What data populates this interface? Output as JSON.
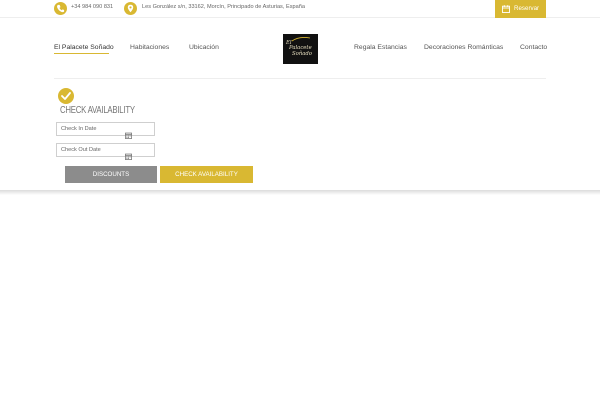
{
  "topbar": {
    "phone": "+34 984 090 831",
    "address": "Les González s/n, 33162, Morcín, Principado de Asturias, España",
    "reserve_label": "Reservar"
  },
  "nav": {
    "left": [
      "El Palacete Soñado",
      "Habitaciones",
      "Ubicación"
    ],
    "right": [
      "Regala Estancias",
      "Decoraciones Románticas",
      "Contacto"
    ],
    "active": "El Palacete Soñado"
  },
  "logo": {
    "line1": "El",
    "line2": "Palacete",
    "line3": "Soñado"
  },
  "availability": {
    "title": "CHECK AVAILABILITY",
    "check_in_placeholder": "Check In Date",
    "check_out_placeholder": "Check Out Date",
    "discounts_label": "DISCOUNTS",
    "submit_label": "CHECK AVAILABILITY"
  },
  "colors": {
    "accent": "#d9b832",
    "grey_button": "#8c8c8c",
    "logo_bg": "#111111"
  },
  "icons": [
    "phone-icon",
    "location-pin-icon",
    "calendar-icon",
    "check-icon"
  ]
}
